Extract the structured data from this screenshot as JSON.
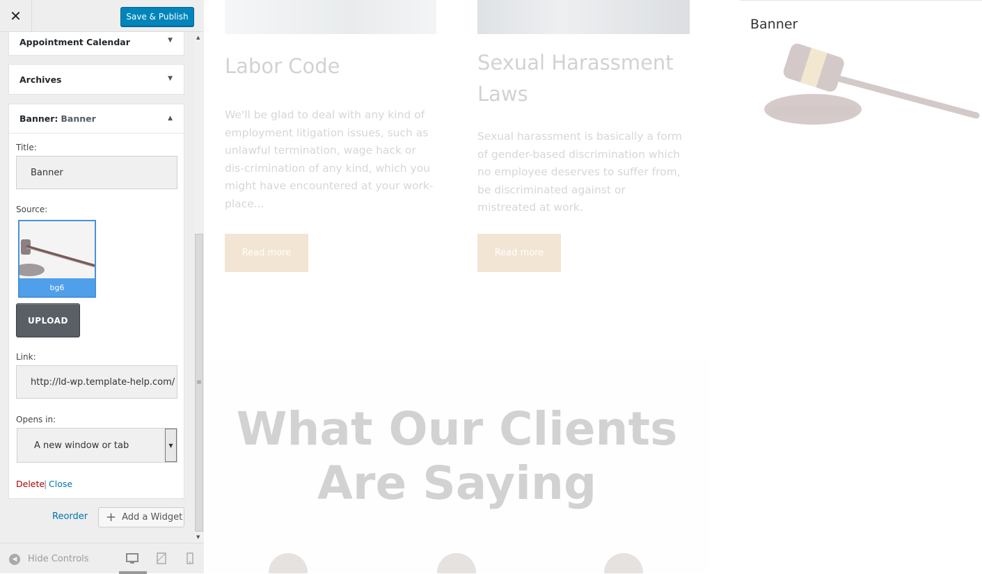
{
  "topbar": {
    "close_glyph": "✕",
    "save_label": "Save & Publish"
  },
  "sections": {
    "appointment": {
      "title": "Appointment Calendar",
      "arrow": "▼"
    },
    "archives": {
      "title": "Archives",
      "arrow": "▼"
    },
    "banner": {
      "title": "Banner:",
      "subtitle": "Banner",
      "arrow": "▲"
    }
  },
  "banner_form": {
    "title_label": "Title:",
    "title_value": "Banner",
    "source_label": "Source:",
    "thumb_caption": "bg6",
    "upload_label": "UPLOAD",
    "link_label": "Link:",
    "link_value": "http://ld-wp.template-help.com/",
    "opens_label": "Opens in:",
    "opens_value": "A new window or tab",
    "delete_label": "Delete",
    "separator": "|",
    "close_label": "Close"
  },
  "actions": {
    "reorder_label": "Reorder",
    "add_widget_label": "Add a Widget"
  },
  "footer": {
    "hide_controls_label": "Hide Controls"
  },
  "preview": {
    "cards": [
      {
        "title": "Labor Code",
        "body": "We'll be glad to deal with any kind of employment litigation issues, such as unlawful termination, wage hack or dis-crimination of any kind, which you might have encountered at your work-place...",
        "button": "Read more"
      },
      {
        "title": "Sexual Harassment Laws",
        "body": "Sexual harassment is basically a form of gender-based discrimination which no employee deserves to suffer from, be discriminated against or mistreated at work.",
        "button": "Read more"
      }
    ],
    "clients_title": "What Our Clients Are Saying",
    "banner_widget_title": "Banner"
  },
  "colors": {
    "accent": "#0085ba",
    "link": "#0073aa",
    "delete": "#aa0000",
    "thumb_caption_bg": "#4f9fea"
  },
  "icons": [
    "close-icon",
    "arrow-down-icon",
    "arrow-up-icon",
    "plus-icon",
    "hide-controls-icon",
    "desktop-icon",
    "tablet-icon",
    "mobile-icon"
  ]
}
